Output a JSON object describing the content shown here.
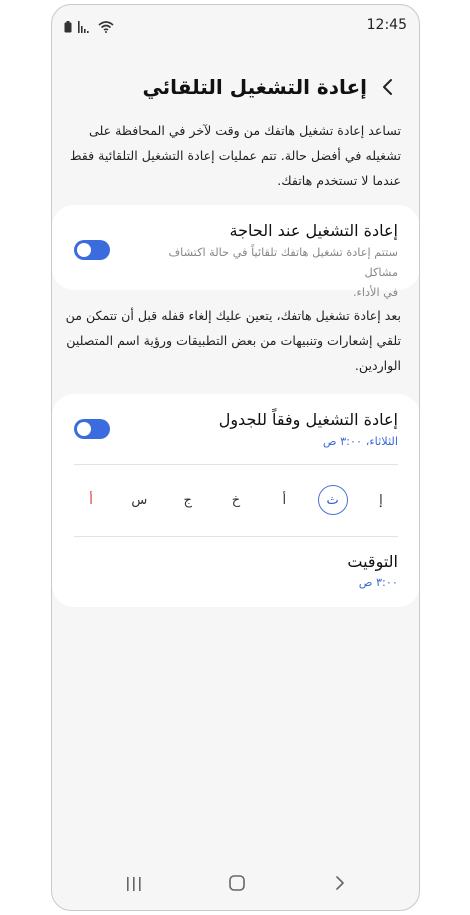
{
  "status_bar": {
    "time": "12:45",
    "icons": [
      "battery-icon",
      "signal-icon",
      "wifi-icon"
    ]
  },
  "header": {
    "title": "إعادة التشغيل التلقائي",
    "back_icon": "chevron-left-icon"
  },
  "intro": {
    "lines": [
      "تساعد إعادة تشغيل هاتفك من وقت لآخر في المحافظة على",
      "تشغيله في أفضل حالة. تتم عمليات إعادة التشغيل التلقائية فقط",
      "عندما لا تستخدم هاتفك."
    ]
  },
  "restart_when_needed": {
    "title": "إعادة التشغيل عند الحاجة",
    "sub_lines": [
      "ستتم إعادة تشغيل هاتفك تلقائياً في حالة اكتشاف مشاكل",
      "في الأداء."
    ],
    "toggle_on": true
  },
  "unlock_note": {
    "lines": [
      "بعد إعادة تشغيل هاتفك، يتعين عليك إلغاء قفله قبل أن تتمكن من",
      "تلقي إشعارات وتنبيهات من بعض التطبيقات ورؤية اسم المتصلين",
      "الواردين."
    ]
  },
  "scheduled_restart": {
    "title": "إعادة التشغيل وفقاً للجدول",
    "subtitle": "الثلاثاء، ٣:٠٠ ص",
    "toggle_on": true,
    "days": [
      {
        "label": "إ",
        "selected": false,
        "red": false
      },
      {
        "label": "ث",
        "selected": true,
        "red": false
      },
      {
        "label": "أ",
        "selected": false,
        "red": false
      },
      {
        "label": "خ",
        "selected": false,
        "red": false
      },
      {
        "label": "ج",
        "selected": false,
        "red": false
      },
      {
        "label": "س",
        "selected": false,
        "red": false
      },
      {
        "label": "أ",
        "selected": false,
        "red": true
      }
    ],
    "timing_label": "التوقيت",
    "timing_value": "٣:٠٠ ص"
  },
  "colors": {
    "accent": "#3b6cde",
    "sunday_red": "#d23b3b",
    "background": "#f6f6f6"
  }
}
